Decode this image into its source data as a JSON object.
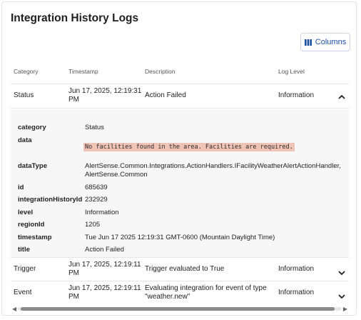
{
  "title": "Integration History Logs",
  "toolbar": {
    "columns_label": "Columns",
    "columns_icon": "columns-icon"
  },
  "table": {
    "headers": [
      "Category",
      "Timestamp",
      "Description",
      "Log Level"
    ],
    "rows": [
      {
        "category": "Status",
        "timestamp_line1": "Jun 17, 2025, 12:19:31",
        "timestamp_line2": "PM",
        "description_line1": "Action Failed",
        "description_line2": "",
        "level": "Information",
        "expanded": true
      },
      {
        "category": "Trigger",
        "timestamp_line1": "Jun 17, 2025, 12:19:11",
        "timestamp_line2": "PM",
        "description_line1": "Trigger evaluated to True",
        "description_line2": "",
        "level": "Information",
        "expanded": false
      },
      {
        "category": "Event",
        "timestamp_line1": "Jun 17, 2025, 12:19:11",
        "timestamp_line2": "PM",
        "description_line1": "Evaluating integration for event of type",
        "description_line2": "\"weather.new\"",
        "level": "Information",
        "expanded": false
      }
    ]
  },
  "detail": {
    "category_key": "category",
    "category_value": "Status",
    "data_key": "data",
    "data_value": "No facilities found in the area. Facilities are required.",
    "dataType_key": "dataType",
    "dataType_value_line1": "AlertSense.Common.Integrations.ActionHandlers.IFacilityWeatherAlertActionHandler,",
    "dataType_value_line2": "AlertSense.Common",
    "id_key": "id",
    "id_value": "685639",
    "integrationHistoryId_key": "integrationHistoryId",
    "integrationHistoryId_value": "232929",
    "level_key": "level",
    "level_value": "Information",
    "regionId_key": "regionId",
    "regionId_value": "1205",
    "timestamp_key": "timestamp",
    "timestamp_value": "Tue Jun 17 2025 12:19:31 GMT-0600 (Mountain Daylight Time)",
    "title_key": "title",
    "title_value": "Action Failed"
  },
  "colors": {
    "accent": "#1e4fa3",
    "highlight": "#efc3b6"
  }
}
